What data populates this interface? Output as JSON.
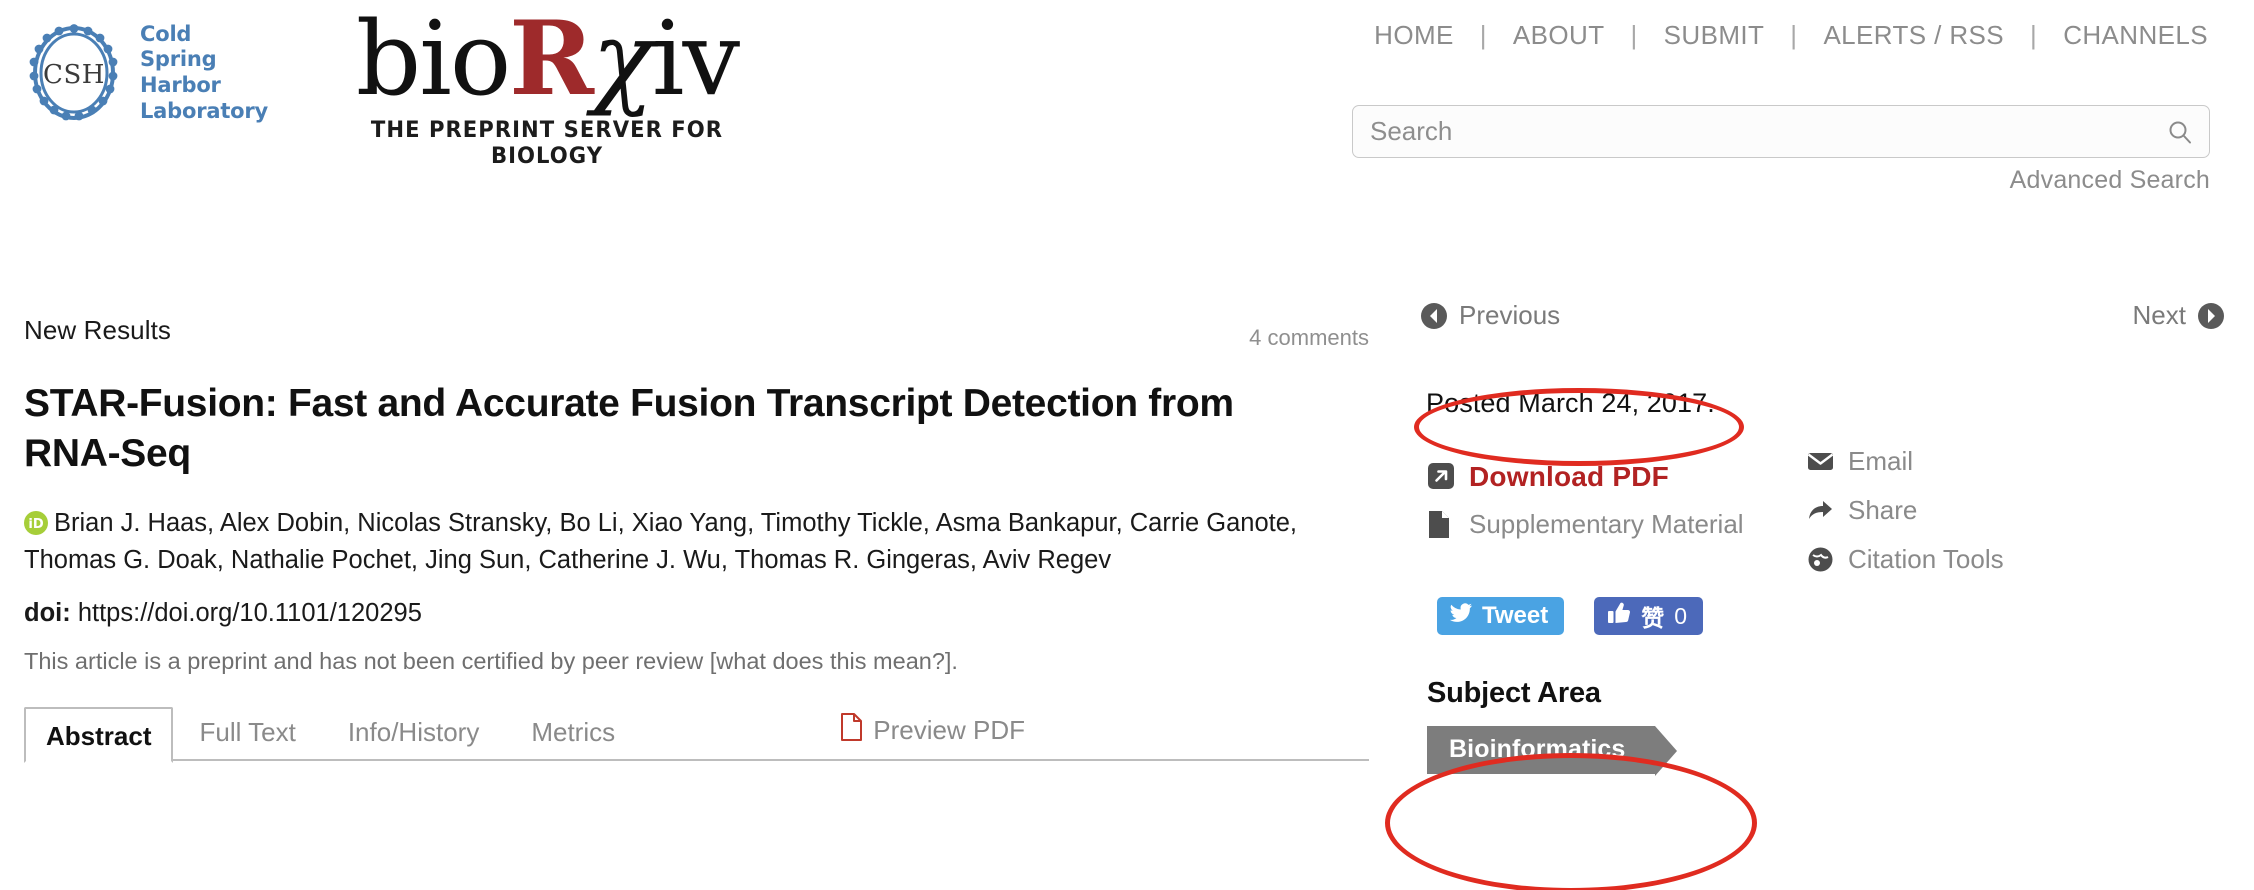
{
  "header": {
    "cshl_logo": {
      "mark_text": "CSH",
      "lines": [
        "Cold",
        "Spring",
        "Harbor",
        "Laboratory"
      ]
    },
    "brand": {
      "part1": "bio",
      "part_r": "R",
      "part_chi": "χ",
      "part3": "iv",
      "tagline": "THE PREPRINT SERVER FOR BIOLOGY"
    },
    "nav": [
      {
        "label": "HOME"
      },
      {
        "label": "ABOUT"
      },
      {
        "label": "SUBMIT"
      },
      {
        "label": "ALERTS / RSS"
      },
      {
        "label": "CHANNELS"
      }
    ],
    "nav_separator": "|",
    "search": {
      "placeholder": "Search",
      "value": "",
      "icon": "search-icon",
      "advanced_label": "Advanced Search"
    }
  },
  "article": {
    "type": "New Results",
    "comments": "4 comments",
    "title": "STAR-Fusion: Fast and Accurate Fusion Transcript Detection from RNA-Seq",
    "authors": "Brian J. Haas, Alex Dobin, Nicolas Stransky, Bo Li, Xiao Yang, Timothy Tickle, Asma Bankapur, Carrie Ganote, Thomas G. Doak, Nathalie Pochet, Jing Sun, Catherine J. Wu, Thomas R. Gingeras, Aviv Regev",
    "orcid_icon": "orcid-id-icon",
    "doi_label": "doi:",
    "doi_url": "https://doi.org/10.1101/120295",
    "preprint_note": "This article is a preprint and has not been certified by peer review [what does this mean?].",
    "tabs": [
      {
        "label": "Abstract",
        "active": true
      },
      {
        "label": "Full Text",
        "active": false
      },
      {
        "label": "Info/History",
        "active": false
      },
      {
        "label": "Metrics",
        "active": false
      }
    ],
    "preview_pdf": "Preview PDF"
  },
  "sidebar": {
    "previous_label": "Previous",
    "next_label": "Next",
    "posted_date": "Posted March 24, 2017.",
    "downloads": [
      {
        "label": "Download PDF",
        "icon": "external-link-icon",
        "primary": true
      },
      {
        "label": "Supplementary Material",
        "icon": "file-icon",
        "primary": false
      }
    ],
    "tools": [
      {
        "label": "Email",
        "icon": "envelope-icon"
      },
      {
        "label": "Share",
        "icon": "share-arrow-icon"
      },
      {
        "label": "Citation Tools",
        "icon": "globe-icon"
      }
    ],
    "social": {
      "tweet_label": "Tweet",
      "tweet_icon": "twitter-bird-icon",
      "like_label": "赞",
      "like_count": "0",
      "like_icon": "thumbs-up-icon"
    },
    "subject_area": {
      "heading": "Subject Area",
      "tags": [
        "Bioinformatics"
      ]
    }
  },
  "colors": {
    "brand_red": "#9e2a2b",
    "download_red": "#b22222",
    "annotation_red": "#e02b20",
    "cshl_blue": "#4a7fb5",
    "twitter_blue": "#4aa3e3",
    "facebook_blue": "#4c69ba",
    "tag_gray": "#7d7d7d"
  }
}
